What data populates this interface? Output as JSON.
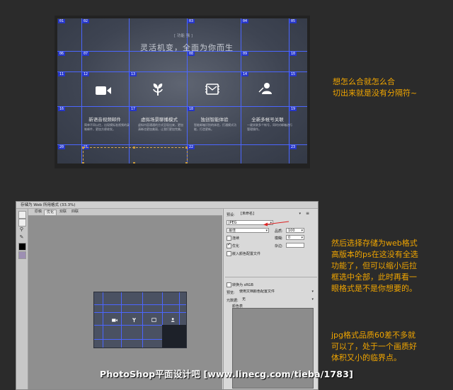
{
  "design": {
    "heading_small": "[ 功能 强 ]",
    "heading_large": "灵活机变，全面为你而生",
    "slices": [
      "01",
      "02",
      "03",
      "04",
      "05",
      "06",
      "07",
      "08",
      "09",
      "10",
      "11",
      "12",
      "13",
      "14",
      "15",
      "16",
      "17",
      "18",
      "19",
      "20",
      "21",
      "22",
      "23"
    ],
    "features": [
      {
        "icon": "video-icon",
        "title": "新语音视频邮件",
        "desc": "简单不同以往，出现模标准视频的录制邮件，更加方便收发。"
      },
      {
        "icon": "leaf-icon",
        "title": "虚拟场景聊播模式",
        "desc": "虚拟内容通通的方式呈现出来，更加清晰也更加美丽，让我们更加完美。"
      },
      {
        "icon": "mail-chip-icon",
        "title": "独创智能体验",
        "desc": "智能邮箱识别的体验，打通模式功能，打造更新。"
      },
      {
        "icon": "link-user-icon",
        "title": "全新多帐号关联",
        "desc": "一键关联多个帐号，同时对邮箱进行管理操作。"
      }
    ]
  },
  "notes": {
    "note1": [
      "想怎么合就怎么合",
      "切出来就是没有分隔符~"
    ],
    "note2": [
      "然后选择存储为web格式",
      "高版本的ps在这没有全选",
      "功能了，但可以缩小后拉",
      "框选中全部，此时再看一",
      "眼格式是不是你想要的。"
    ],
    "note3": [
      "jpg格式品质60差不多就",
      "可以了，处于一个画质好",
      "体积又小的临界点。"
    ]
  },
  "dialog": {
    "title": "存储为 Web 所用格式 (33.3%)",
    "tabs": [
      "原稿",
      "优化",
      "双联",
      "四联"
    ],
    "preset_label": "预设:",
    "preset_value": "[未命名]",
    "format_value": "JPEG",
    "quality_level": "最佳",
    "quality_label": "品质:",
    "quality_value": "100",
    "progressive_label": "连续",
    "blur_label": "模糊:",
    "blur_value": "0",
    "optimized_label": "优化",
    "matte_label": "杂边:",
    "embed_profile_label": "嵌入颜色配置文件",
    "convert_srgb_label": "转换为 sRGB",
    "preview_label": "预览:",
    "preview_value": "使用文档颜色配置文件",
    "metadata_label": "元数据:",
    "metadata_value": "无",
    "color_table_label": "颜色表"
  },
  "watermark": "PhotoShop平面设计吧  [www.linecg.com/tieba/1783]"
}
